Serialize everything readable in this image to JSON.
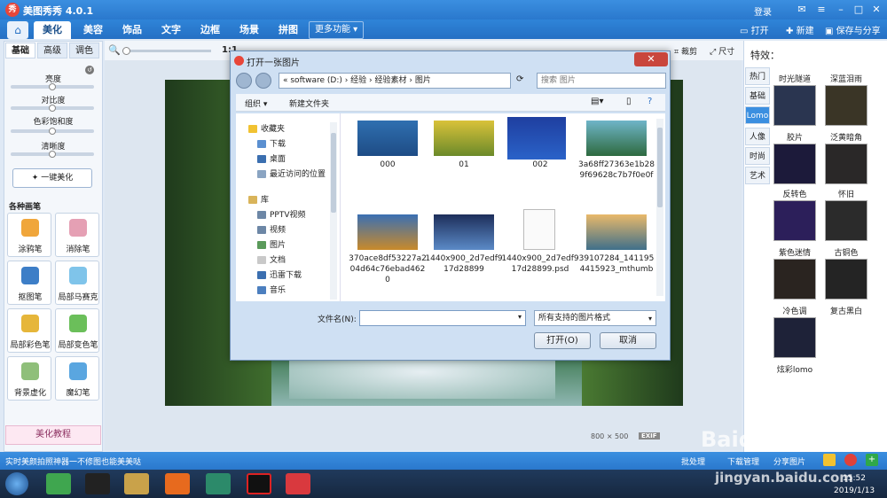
{
  "app": {
    "title": "美图秀秀 4.0.1",
    "login": "登录"
  },
  "menu": {
    "tabs": [
      "美化",
      "美容",
      "饰品",
      "文字",
      "边框",
      "场景",
      "拼图"
    ],
    "more": "更多功能",
    "open": "打开",
    "new": "新建",
    "save_share": "保存与分享"
  },
  "left": {
    "tabs": [
      "基础",
      "高级",
      "调色"
    ],
    "sliders": [
      "亮度",
      "对比度",
      "色彩饱和度",
      "清晰度"
    ],
    "one_key": "一键美化",
    "brushes_title": "各种画笔",
    "tools": [
      "涂鸦笔",
      "消除笔",
      "抠图笔",
      "局部马赛克",
      "局部彩色笔",
      "局部变色笔",
      "背景虚化",
      "魔幻笔"
    ],
    "tutorial": "美化教程"
  },
  "toolbar": {
    "zoom": "1:1",
    "crop": "裁剪",
    "size": "尺寸"
  },
  "canvas": {
    "dims": "800 × 500",
    "exif": "EXIF"
  },
  "right": {
    "title": "特效：",
    "tabs": [
      "热门",
      "基础",
      "Lomo",
      "人像",
      "时尚",
      "艺术"
    ],
    "effects": [
      "时光隧道",
      "深蓝泪雨",
      "胶片",
      "泛黄暗角",
      "反转色",
      "怀旧",
      "紫色迷情",
      "古铜色",
      "冷色调",
      "复古黑白",
      "炫彩lomo"
    ]
  },
  "dialog": {
    "title": "打开一张图片",
    "address": "«  software (D:)  ›  经验  ›  经验素材  ›  图片",
    "search_placeholder": "搜索 图片",
    "organize": "组织 ▾",
    "new_folder": "新建文件夹",
    "tree": [
      "收藏夹",
      "下载",
      "桌面",
      "最近访问的位置",
      "库",
      "PPTV视频",
      "视频",
      "图片",
      "文档",
      "迅雷下载",
      "音乐"
    ],
    "files": [
      "000",
      "01",
      "002",
      "3a68ff27363e1b289f69628c7b7f0e0f",
      "370ace8df53227a204d64c76ebad4620",
      "1440x900_2d7edf917d28899",
      "1440x900_2d7edf917d28899.psd",
      "39107284_1411954415923_mthumb"
    ],
    "filename_label": "文件名(N):",
    "filetype": "所有支持的图片格式",
    "open_btn": "打开(O)",
    "cancel_btn": "取消"
  },
  "status": {
    "left": "实时美颜拍照神器一不修图也能美美哒",
    "batch": "批处理",
    "download": "下载管理",
    "share": "分享图片"
  },
  "taskbar": {
    "time": "15:52",
    "date": "2019/1/13"
  },
  "watermark": {
    "text": "Baidu 经验",
    "url": "jingyan.baidu.com"
  }
}
